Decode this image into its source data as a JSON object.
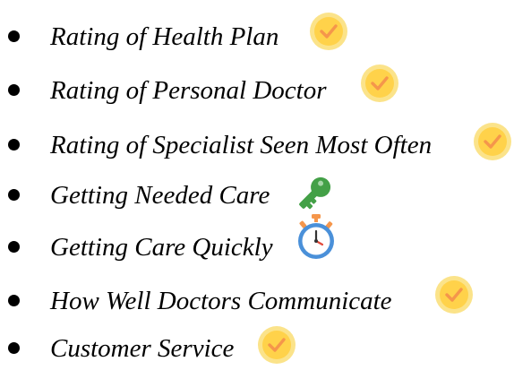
{
  "colors": {
    "text": "#000000",
    "check_badge_fill": "#FFD24A",
    "check_badge_ring": "#FBE38A",
    "check_mark": "#F5964B",
    "key_green": "#43A047",
    "stopwatch_blue": "#4A90D9",
    "stopwatch_orange": "#F5964B"
  },
  "items": [
    {
      "label": "Rating of Health Plan",
      "icon": "check-badge-icon"
    },
    {
      "label": "Rating of Personal Doctor",
      "icon": "check-badge-icon"
    },
    {
      "label": "Rating of Specialist Seen Most Often",
      "icon": "check-badge-icon"
    },
    {
      "label": "Getting Needed Care",
      "icon": "key-icon"
    },
    {
      "label": "Getting Care Quickly",
      "icon": "stopwatch-icon"
    },
    {
      "label": "How Well Doctors Communicate",
      "icon": "check-badge-icon"
    },
    {
      "label": "Customer Service",
      "icon": "check-badge-icon"
    }
  ]
}
